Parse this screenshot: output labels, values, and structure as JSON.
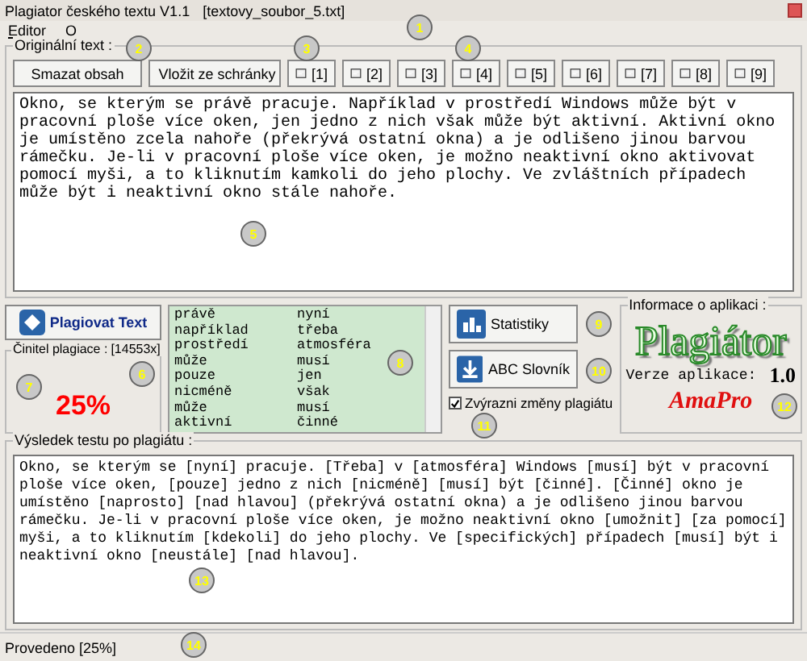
{
  "window": {
    "title": "Plagiator českého textu V1.1",
    "file": "[textovy_soubor_5.txt]"
  },
  "menu": [
    "Editor",
    "O"
  ],
  "original": {
    "label": "Originální text :",
    "buttons": [
      {
        "label": "Smazat obsah",
        "kind": "clear"
      },
      {
        "label": "Vložit ze schránky",
        "kind": "paste"
      }
    ],
    "slots": [
      "[1]",
      "[2]",
      "[3]",
      "[4]",
      "[5]",
      "[6]",
      "[7]",
      "[8]",
      "[9]"
    ],
    "text": "Okno, se kterým se právě pracuje. Například v prostředí Windows může být v pracovní ploše více oken, jen jedno z nich však může být aktivní. Aktivní okno je umístěno zcela nahoře (překrývá ostatní okna) a je odlišeno jinou barvou rámečku. Je-li v pracovní ploše více oken, je možno neaktivní okno aktivovat pomocí myši, a to kliknutím kamkoli do jeho plochy. Ve zvláštních případech může být i neaktivní okno stále nahoře."
  },
  "plagiate_button": "Plagiovat Text",
  "factor": {
    "label": "Činitel plagiace :",
    "count": "[14553x]",
    "value": "25%"
  },
  "words": [
    [
      "právě",
      "nyní"
    ],
    [
      "například",
      "třeba"
    ],
    [
      "prostředí",
      "atmosféra"
    ],
    [
      "může",
      "musí"
    ],
    [
      "pouze",
      "jen"
    ],
    [
      "nicméně",
      "však"
    ],
    [
      "může",
      "musí"
    ],
    [
      "aktivní",
      "činné"
    ]
  ],
  "actions": [
    {
      "label": "Statistiky",
      "kind": "stats"
    },
    {
      "label": "ABC Slovník",
      "kind": "dict"
    }
  ],
  "highlight": {
    "label": "Zvýrazni změny plagiátu",
    "checked": true
  },
  "info": {
    "label": "Informace o aplikaci :",
    "logo": "Plagiátor",
    "version_label": "Verze aplikace:",
    "version": "1.0",
    "author": "AmaPro"
  },
  "result": {
    "label": "Výsledek testu po plagiátu :",
    "text": "Okno, se kterým se [nyní] pracuje. [Třeba] v [atmosféra] Windows [musí] být v pracovní ploše více oken, [pouze] jedno z nich [nicméně] [musí] být [činné]. [Činné] okno je umístěno [naprosto] [nad hlavou] (překrývá ostatní okna) a je odlišeno jinou barvou rámečku. Je-li v pracovní ploše více oken, je možno neaktivní okno [umožnit] [za pomocí] myši, a to kliknutím [kdekoli] do jeho plochy. Ve [specifických] případech [musí] být i neaktivní okno [neustále] [nad hlavou]."
  },
  "status": "Provedeno [25%]",
  "callouts": [
    "1",
    "2",
    "3",
    "4",
    "5",
    "6",
    "7",
    "8",
    "9",
    "10",
    "11",
    "12",
    "13",
    "14"
  ]
}
